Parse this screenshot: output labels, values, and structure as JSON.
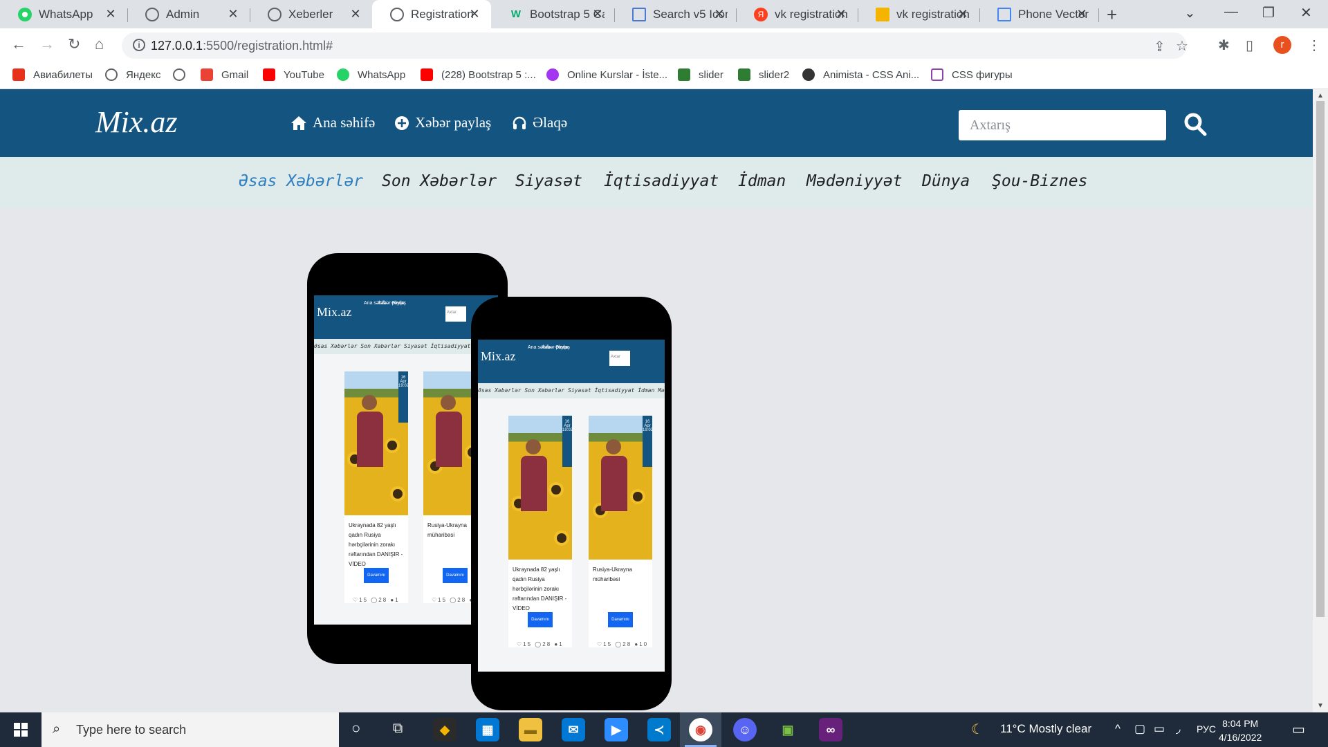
{
  "browser": {
    "tabs": [
      {
        "label": "WhatsApp",
        "icon": "whatsapp-icon",
        "color": "#25d366"
      },
      {
        "label": "Admin",
        "icon": "globe-icon",
        "color": "#5f6368"
      },
      {
        "label": "Xeberler",
        "icon": "globe-icon",
        "color": "#5f6368"
      },
      {
        "label": "Registration",
        "icon": "globe-icon",
        "color": "#5f6368"
      },
      {
        "label": "Bootstrap 5 Ca",
        "icon": "w3schools-icon",
        "color": "#04aa6d"
      },
      {
        "label": "Search v5 Icon",
        "icon": "flag-icon",
        "color": "#4a7ad4"
      },
      {
        "label": "vk registration",
        "icon": "yandex-icon",
        "color": "#fc3f1d"
      },
      {
        "label": "vk registration",
        "icon": "image-icon",
        "color": "#f4b400"
      },
      {
        "label": "Phone Vector",
        "icon": "grid-icon",
        "color": "#4285f4"
      }
    ],
    "active_tab": 3,
    "new_tab": "+",
    "url_host": "127.0.0.1",
    "url_path": ":5500/registration.html#",
    "profile_initial": "r",
    "bookmarks": [
      {
        "label": "Авиабилеты",
        "icon": "aviasales-icon",
        "color": "#e8311a"
      },
      {
        "label": "Яндекс",
        "icon": "globe-icon",
        "color": "#5f6368"
      },
      {
        "label": "",
        "icon": "globe-icon",
        "color": "#5f6368"
      },
      {
        "label": "Gmail",
        "icon": "gmail-icon",
        "color": "#ea4335"
      },
      {
        "label": "YouTube",
        "icon": "youtube-icon",
        "color": "#ff0000"
      },
      {
        "label": "WhatsApp",
        "icon": "whatsapp-icon",
        "color": "#25d366"
      },
      {
        "label": "(228) Bootstrap 5 :...",
        "icon": "youtube-icon",
        "color": "#ff0000"
      },
      {
        "label": "Online Kurslar - İste...",
        "icon": "udemy-icon",
        "color": "#a435f0"
      },
      {
        "label": "slider",
        "icon": "leaf-icon",
        "color": "#2e7d32"
      },
      {
        "label": "slider2",
        "icon": "leaf-icon",
        "color": "#2e7d32"
      },
      {
        "label": "Animista - CSS Ani...",
        "icon": "animista-icon",
        "color": "#333333"
      },
      {
        "label": "CSS фигуры",
        "icon": "htmlbook-icon",
        "color": "#8e44ad"
      }
    ]
  },
  "site": {
    "logo": "Mix.az",
    "topnav": [
      {
        "label": "Ana səhifə",
        "icon": "home-icon"
      },
      {
        "label": "Xəbər paylaş",
        "icon": "plus-circle-icon"
      },
      {
        "label": "Əlaqə",
        "icon": "headphones-icon"
      }
    ],
    "search_placeholder": "Axtarış",
    "categories": [
      "Əsas Xəbərlər",
      "Son Xəbərlər",
      "Siyasət",
      "İqtisadiyyat",
      "İdman",
      "Mədəniyyət",
      "Dünya",
      "Şou-Biznes"
    ],
    "active_category": 0,
    "mockup": {
      "logo": "Mix.az",
      "nav": [
        "Ana səhifə",
        "Xəbər paylaş",
        "Əlaqə"
      ],
      "search": "Axtar",
      "cats": "Əsas Xəbərlər  Son Xəbərlər  Siyasət  İqtisadiyyat  İdman  Mədəniyyət  Dünya",
      "cards": [
        {
          "title": "Ukraynada 82 yaşlı qadın Rusiya hərbçilərinin zorakı rəftarından DANIŞIR - VİDEO",
          "button": "Davamını oxu",
          "date": "16 Apr 19:02",
          "stats": "♡15 ◯28 ●1"
        },
        {
          "title": "Rusiya-Ukrayna müharibəsi",
          "button": "Davamını oxu",
          "date": "16 Apr 19:02",
          "stats": "♡15 ◯28 ●10"
        }
      ]
    }
  },
  "taskbar": {
    "search_placeholder": "Type here to search",
    "weather": "11°C  Mostly clear",
    "lang": "РУС",
    "time": "8:04 PM",
    "date": "4/16/2022"
  }
}
